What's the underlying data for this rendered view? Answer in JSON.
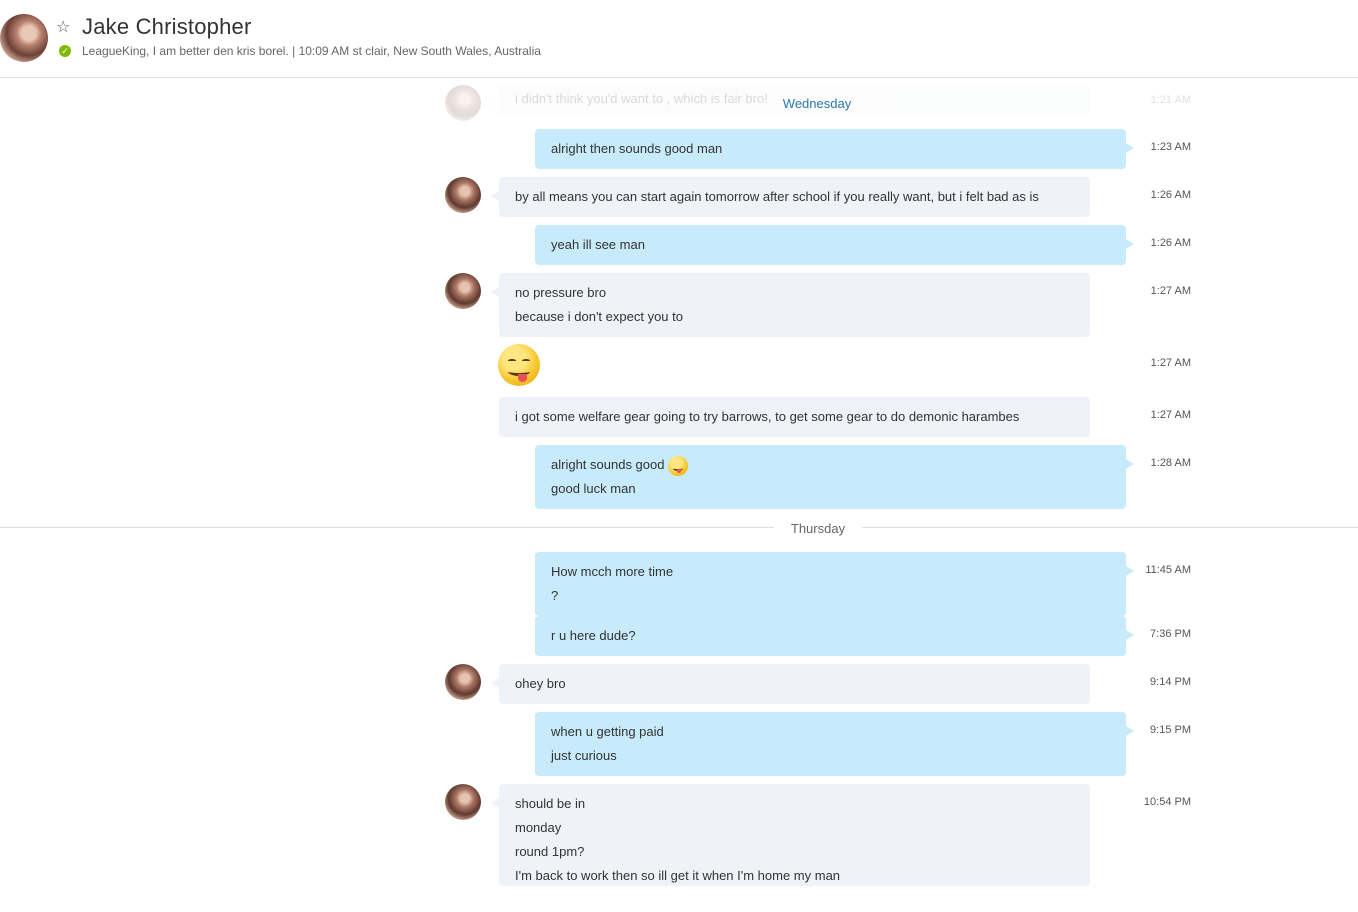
{
  "header": {
    "name": "Jake Christopher",
    "mood": "LeagueKing, I am better den kris borel.  |  10:09 AM st clair, New South Wales, Australia"
  },
  "days": {
    "wednesday": "Wednesday",
    "thursday": "Thursday"
  },
  "messages": [
    {
      "dir": "in",
      "lines": [
        "i didn't think you'd want to , which is fair bro!"
      ],
      "time": "1:21 AM"
    },
    {
      "dir": "out",
      "lines": [
        "alright then sounds good man"
      ],
      "time": "1:23 AM"
    },
    {
      "dir": "in",
      "lines": [
        "by all means you can start again tomorrow after school if you really want, but i felt bad as is"
      ],
      "time": "1:26 AM"
    },
    {
      "dir": "out",
      "lines": [
        "yeah ill see man"
      ],
      "time": "1:26 AM"
    },
    {
      "dir": "in",
      "lines": [
        "no pressure bro",
        "because i don't expect you to"
      ],
      "time": "1:27 AM"
    },
    {
      "dir": "in",
      "lines": [],
      "emoji": "tongue-wink-emoji",
      "time": "1:27 AM"
    },
    {
      "dir": "in",
      "lines": [
        "i got some welfare gear going to try barrows, to get some gear to do demonic harambes"
      ],
      "time": "1:27 AM"
    },
    {
      "dir": "out",
      "lines": [
        "alright sounds good",
        "good luck man"
      ],
      "time": "1:28 AM"
    },
    {
      "dir": "out",
      "lines": [
        "How mcch more time",
        "?"
      ],
      "time": "11:45 AM"
    },
    {
      "dir": "out",
      "lines": [
        "r u here dude?"
      ],
      "time": "7:36 PM"
    },
    {
      "dir": "in",
      "lines": [
        "ohey bro"
      ],
      "time": "9:14 PM"
    },
    {
      "dir": "out",
      "lines": [
        "when u getting paid",
        "just curious"
      ],
      "time": "9:15 PM"
    },
    {
      "dir": "in",
      "lines": [
        "should be in",
        "monday",
        "round 1pm?",
        "I'm back to work then so ill get it when I'm home my man"
      ],
      "time": "10:54 PM"
    }
  ],
  "colors": {
    "outgoing_bubble": "#c7ebfb",
    "incoming_bubble": "#eff2f6",
    "presence_online": "#7fba00",
    "day_label_accent": "#2a7ab0"
  }
}
